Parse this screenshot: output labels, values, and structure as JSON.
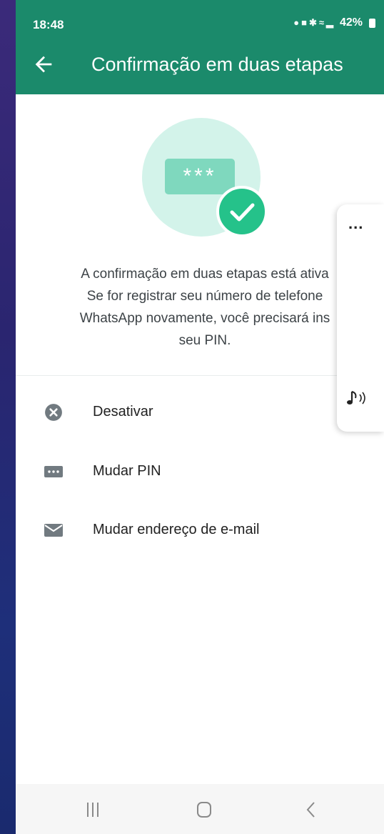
{
  "status_bar": {
    "time": "18:48",
    "icons": [
      "photo-icon",
      "notification-icon",
      "bluetooth-icon",
      "wifi-icon",
      "volte-icon",
      "signal-icon"
    ],
    "battery": "42%"
  },
  "app_bar": {
    "title": "Confirmação em duas etapas",
    "back_icon": "arrow-left-icon"
  },
  "hero": {
    "pin_mask": "***",
    "check_icon": "check-icon"
  },
  "description": {
    "lines": [
      "A confirmação em duas etapas está ativa",
      "Se for registrar seu número de telefone",
      "WhatsApp novamente, você precisará ins",
      "seu PIN."
    ]
  },
  "menu": {
    "items": [
      {
        "icon": "cancel-circle-icon",
        "label": "Desativar"
      },
      {
        "icon": "pin-keyboard-icon",
        "label": "Mudar PIN"
      },
      {
        "icon": "envelope-icon",
        "label": "Mudar endereço de e-mail"
      }
    ]
  },
  "side_panel": {
    "more_label": "...",
    "sound_icon": "music-note-sound-icon"
  },
  "nav_bar": {
    "buttons": [
      "recent-apps-icon",
      "home-icon",
      "back-icon"
    ]
  },
  "colors": {
    "accent": "#1b8a6b",
    "hero_bg": "#d3f3ea",
    "check": "#25c28a",
    "icon_gray": "#717a80"
  }
}
